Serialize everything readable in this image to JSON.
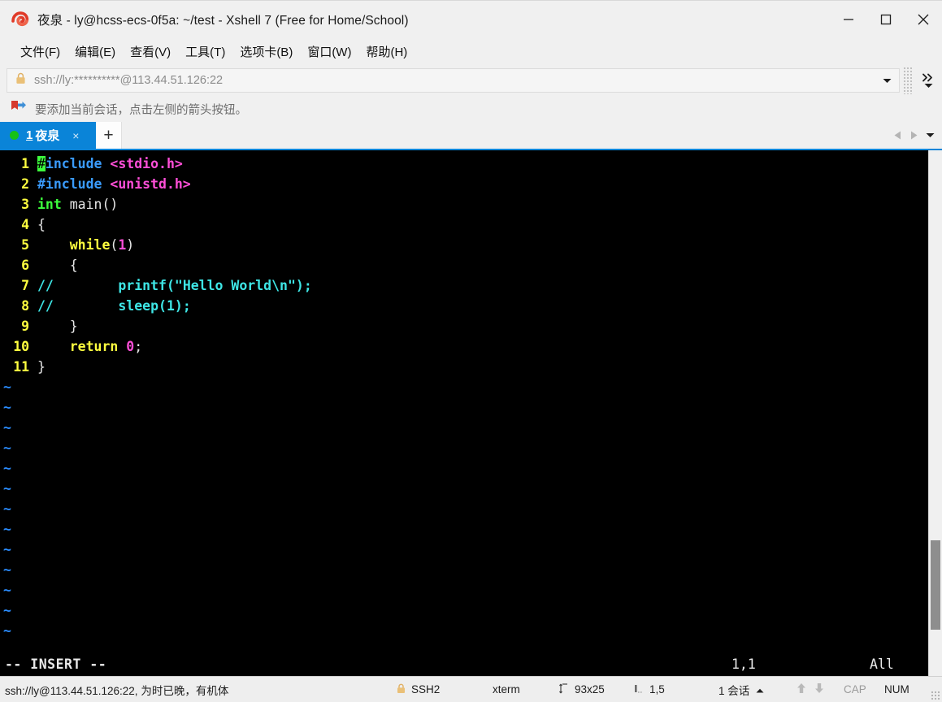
{
  "window": {
    "title": "夜泉 - ly@hcss-ecs-0f5a: ~/test - Xshell 7 (Free for Home/School)",
    "logo_icon": "xshell-spiral-logo",
    "minimize_icon": "minimize-icon",
    "maximize_icon": "maximize-icon",
    "close_icon": "close-icon",
    "accent_color": "#0a84d8"
  },
  "menubar": {
    "items": [
      {
        "label": "文件(F)"
      },
      {
        "label": "编辑(E)"
      },
      {
        "label": "查看(V)"
      },
      {
        "label": "工具(T)"
      },
      {
        "label": "选项卡(B)"
      },
      {
        "label": "窗口(W)"
      },
      {
        "label": "帮助(H)"
      }
    ]
  },
  "addressbar": {
    "lock_icon": "padlock-icon",
    "value": "ssh://ly:**********@113.44.51.126:22",
    "dropdown_icon": "chevron-down-icon",
    "overflow_icon": "double-chevron-right-icon",
    "overflow_dropdown_icon": "chevron-down-icon"
  },
  "infobar": {
    "icon": "bookmark-flag-icon",
    "text": "要添加当前会话，点击左侧的箭头按钮。"
  },
  "tabstrip": {
    "tabs": [
      {
        "number": "1",
        "label": "夜泉",
        "status_dot": "connected-green-dot",
        "close_label": "×",
        "active": true
      }
    ],
    "new_tab_label": "+",
    "nav_prev_icon": "triangle-left-icon",
    "nav_next_icon": "triangle-right-icon",
    "nav_list_icon": "chevron-down-icon"
  },
  "terminal": {
    "lines": [
      {
        "num": "1",
        "tokens": [
          {
            "t": "#",
            "c": "cursor"
          },
          {
            "t": "include ",
            "c": "c-blue"
          },
          {
            "t": "<stdio.h>",
            "c": "c-mag"
          }
        ]
      },
      {
        "num": "2",
        "tokens": [
          {
            "t": "#include ",
            "c": "c-blue"
          },
          {
            "t": "<unistd.h>",
            "c": "c-mag"
          }
        ]
      },
      {
        "num": "3",
        "tokens": [
          {
            "t": "int ",
            "c": "c-green"
          },
          {
            "t": "main()",
            "c": "c-white"
          }
        ]
      },
      {
        "num": "4",
        "tokens": [
          {
            "t": "{",
            "c": "c-white"
          }
        ]
      },
      {
        "num": "5",
        "tokens": [
          {
            "t": "    ",
            "c": "c-white"
          },
          {
            "t": "while",
            "c": "c-yellow"
          },
          {
            "t": "(",
            "c": "c-white"
          },
          {
            "t": "1",
            "c": "c-magenta"
          },
          {
            "t": ")",
            "c": "c-white"
          }
        ]
      },
      {
        "num": "6",
        "tokens": [
          {
            "t": "    {",
            "c": "c-white"
          }
        ]
      },
      {
        "num": "7",
        "tokens": [
          {
            "t": "//",
            "c": "c-cyan"
          },
          {
            "t": "        printf(\"Hello World\\n\");",
            "c": "c-cyan"
          }
        ]
      },
      {
        "num": "8",
        "tokens": [
          {
            "t": "//",
            "c": "c-cyan"
          },
          {
            "t": "        sleep(1);",
            "c": "c-cyan"
          }
        ]
      },
      {
        "num": "9",
        "tokens": [
          {
            "t": "    }",
            "c": "c-white"
          }
        ]
      },
      {
        "num": "10",
        "tokens": [
          {
            "t": "    ",
            "c": "c-white"
          },
          {
            "t": "return ",
            "c": "c-yellow"
          },
          {
            "t": "0",
            "c": "c-magenta"
          },
          {
            "t": ";",
            "c": "c-white"
          }
        ]
      },
      {
        "num": "11",
        "tokens": [
          {
            "t": "}",
            "c": "c-white"
          }
        ]
      }
    ],
    "tilde_count": 13,
    "tilde_char": "~",
    "status": {
      "mode": "-- INSERT --",
      "position": "1,1",
      "scroll": "All"
    }
  },
  "statusbar": {
    "connection": "ssh://ly@113.44.51.126:22, 为时已晚，有机体",
    "protocol_icon": "padlock-icon",
    "protocol": "SSH2",
    "term_type": "xterm",
    "size_icon": "resize-icon",
    "size": "93x25",
    "cursor_icon": "cursor-pos-icon",
    "cursor_pos": "1,5",
    "sessions": "1 会话",
    "sessions_caret_icon": "caret-up-icon",
    "upload_icon": "arrow-up-icon",
    "download_icon": "arrow-down-icon",
    "caps_lock": "CAP",
    "num_lock": "NUM",
    "resize_grip_icon": "resize-grip-icon"
  }
}
